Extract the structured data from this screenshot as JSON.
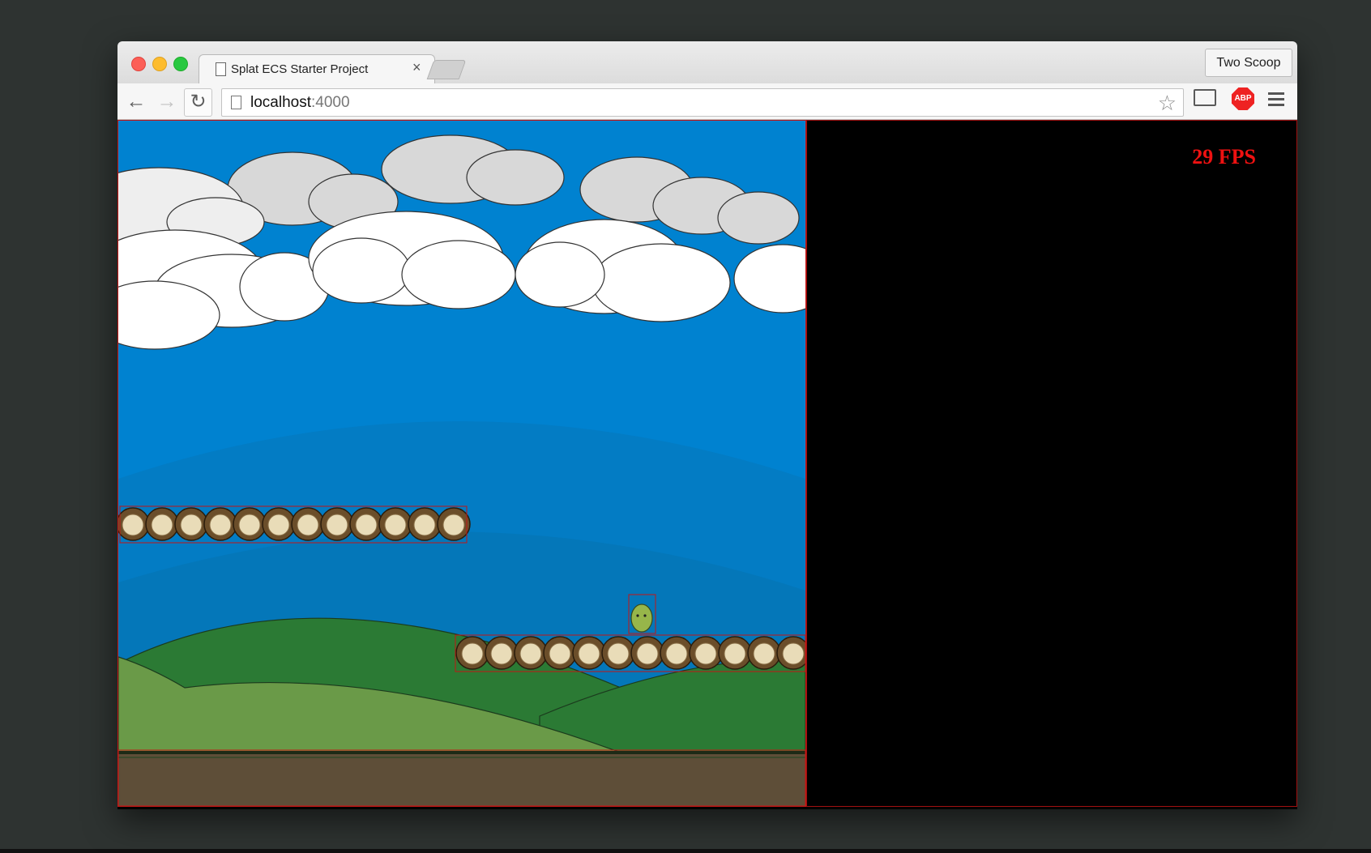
{
  "browser": {
    "tab": {
      "title": "Splat ECS Starter Project"
    },
    "profile_button": "Two Scoop",
    "url": {
      "host": "localhost",
      "port": ":4000"
    },
    "icons": [
      "back-arrow-icon",
      "forward-arrow-icon",
      "reload-icon",
      "page-icon",
      "star-icon",
      "cast-icon",
      "adblock-icon",
      "menu-icon"
    ]
  },
  "game": {
    "fps_label": "29 FPS",
    "colors": {
      "sky": "#0082d0",
      "far_hill": "#0478bb",
      "grass_dark": "#2b7a34",
      "grass_light": "#6a9a48",
      "ground": "#5e4e38",
      "debug_outline": "#c31515"
    },
    "scene": {
      "clouds": 2,
      "platforms": [
        {
          "name": "upper-log-platform",
          "logs": 12
        },
        {
          "name": "lower-log-platform",
          "logs": 12
        }
      ],
      "player": "green-blob-character"
    }
  }
}
